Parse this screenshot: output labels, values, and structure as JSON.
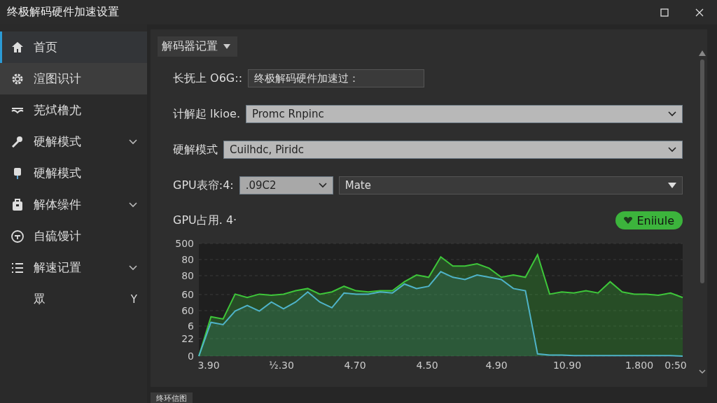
{
  "window": {
    "title": "终极解码硬件加速设置"
  },
  "sidebar": {
    "items": [
      {
        "kind": "item",
        "label": "首页",
        "selected": true,
        "hovered": false,
        "has_submenu": false
      },
      {
        "kind": "item",
        "label": "渲图识计",
        "selected": false,
        "hovered": true,
        "has_submenu": false
      },
      {
        "kind": "item",
        "label": "芜烒橹尤",
        "selected": false,
        "hovered": false,
        "has_submenu": false
      },
      {
        "kind": "item",
        "label": "硬解模式",
        "selected": false,
        "hovered": false,
        "has_submenu": true
      },
      {
        "kind": "item",
        "label": "硬解模式",
        "selected": false,
        "hovered": false,
        "has_submenu": false
      },
      {
        "kind": "item",
        "label": "解体缲件",
        "selected": false,
        "hovered": false,
        "has_submenu": true
      },
      {
        "kind": "item",
        "label": "自硫馒计",
        "selected": false,
        "hovered": false,
        "has_submenu": false
      },
      {
        "kind": "item",
        "label": "解速记置",
        "selected": false,
        "hovered": false,
        "has_submenu": true
      },
      {
        "kind": "subitem",
        "label": "眾",
        "suffix": "Y",
        "selected": false,
        "hovered": false,
        "has_submenu": false
      }
    ]
  },
  "panel": {
    "header": "解码器记置",
    "fields": [
      {
        "label": "长抚上 O6G::",
        "controls": [
          {
            "kind": "text",
            "value": "终极解码硬件加速过："
          }
        ]
      },
      {
        "label": "计解起 lkioe.",
        "controls": [
          {
            "kind": "light_select",
            "value": "Promc Rnpinc"
          }
        ]
      },
      {
        "label": "硬解模式",
        "controls": [
          {
            "kind": "light_select",
            "value": "Cuilhdc, Piridc"
          }
        ]
      },
      {
        "label": "GPU表帘:4:",
        "controls": [
          {
            "kind": "light_select",
            "value": ".09C2"
          },
          {
            "kind": "dark_select",
            "value": "Mate"
          }
        ]
      }
    ]
  },
  "usage": {
    "label": "GPU占用. 4·",
    "toggle": {
      "label": "Eniiule",
      "on": true
    },
    "graph": {
      "y_axis_labels": [
        "500",
        "80",
        "80",
        "60",
        "60",
        "6",
        "22",
        "0"
      ],
      "x_axis_labels": [
        "3.90",
        "½.30",
        "4.70",
        "4.50",
        "4.90",
        "10.90",
        "1.800",
        "0:50"
      ]
    }
  },
  "bottom_tab": {
    "label": "终环信图"
  }
}
